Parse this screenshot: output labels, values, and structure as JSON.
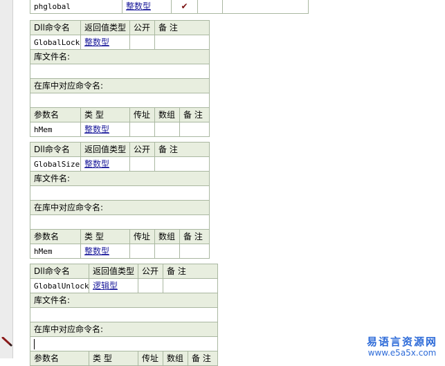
{
  "top_row": {
    "name": "phglobal",
    "type": "整数型",
    "check": "✔"
  },
  "labels": {
    "dll_cmd": "Dll命令名",
    "return_type": "返回值类型",
    "public": "公开",
    "remark": "备 注",
    "lib_file": "库文件名:",
    "lib_cmd": "在库中对应命令名:",
    "param_name": "参数名",
    "param_type": "类 型",
    "by_ref": "传址",
    "array": "数组"
  },
  "blocks": [
    {
      "dll_name": "GlobalLock",
      "return_type": "整数型",
      "param": {
        "name": "hMem",
        "type": "整数型"
      }
    },
    {
      "dll_name": "GlobalSize",
      "return_type": "整数型",
      "param": {
        "name": "hMem",
        "type": "整数型"
      }
    },
    {
      "dll_name": "GlobalUnlock",
      "return_type": "逻辑型",
      "param": {
        "name": "参数名",
        "type": "类 型"
      }
    }
  ],
  "watermark": {
    "title": "易语言资源网",
    "url": "www.e5a5x.com"
  },
  "colors": {
    "header_bg": "#e8eedf",
    "border": "#a9b7a0",
    "link": "#1a1a9a",
    "brand": "#2c6ad8"
  }
}
